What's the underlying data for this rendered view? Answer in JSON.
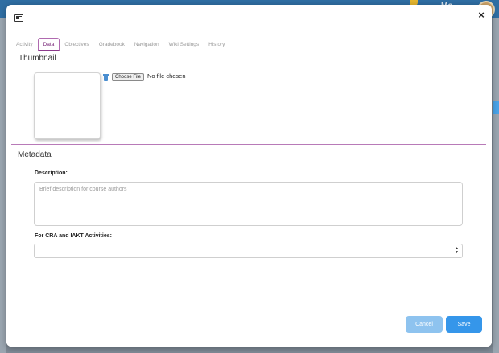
{
  "background": {
    "user_name": "Mo"
  },
  "header": {
    "app_icon": "window-icon",
    "close_label": "×"
  },
  "tabs": [
    {
      "label": "Activity",
      "active": false
    },
    {
      "label": "Data",
      "active": true
    },
    {
      "label": "Objectives",
      "active": false
    },
    {
      "label": "Gradebook",
      "active": false
    },
    {
      "label": "Navigation",
      "active": false
    },
    {
      "label": "Wiki Settings",
      "active": false
    },
    {
      "label": "History",
      "active": false
    }
  ],
  "thumbnail": {
    "title": "Thumbnail",
    "delete_icon": "trash-icon",
    "choose_file_label": "Choose File",
    "file_status": "No file chosen"
  },
  "metadata": {
    "title": "Metadata",
    "description_label": "Description:",
    "description_value": "",
    "description_placeholder": "Brief description for course authors",
    "cra_label": "For CRA and IAKT Activities:",
    "cra_selected": ""
  },
  "footer": {
    "cancel_label": "Cancel",
    "save_label": "Save"
  },
  "colors": {
    "accent": "#8c3a8c",
    "primary_button": "#3596ea",
    "secondary_button": "#8ec3ef",
    "top_bar": "#2f6ea3"
  }
}
